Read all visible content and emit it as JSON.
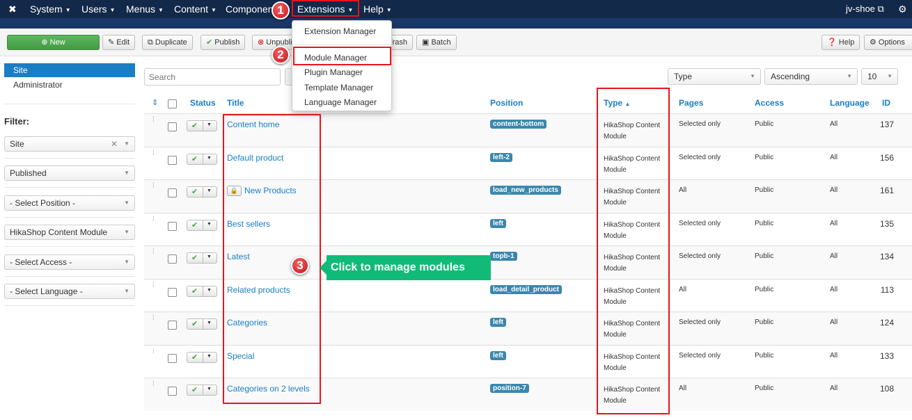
{
  "topnav": {
    "items": [
      "System",
      "Users",
      "Menus",
      "Content",
      "Components",
      "Extensions",
      "Help"
    ],
    "user": "jv-shoe",
    "gear_icon": "gear-icon"
  },
  "toolbar": {
    "new": "New",
    "edit": "Edit",
    "duplicate": "Duplicate",
    "publish": "Publish",
    "unpublish": "Unpublish",
    "trash": "Trash",
    "batch": "Batch",
    "help": "Help",
    "options": "Options"
  },
  "extensions_menu": [
    "Extension Manager",
    "Module Manager",
    "Plugin Manager",
    "Template Manager",
    "Language Manager"
  ],
  "sidebar": {
    "items": [
      "Site",
      "Administrator"
    ],
    "filter_label": "Filter:",
    "filters": [
      "Site",
      "Published",
      "- Select Position -",
      "HikaShop Content Module",
      "- Select Access -",
      "- Select Language -"
    ]
  },
  "search": {
    "placeholder": "Search"
  },
  "sorting": {
    "field": "Type",
    "direction": "Ascending",
    "limit": "10"
  },
  "table": {
    "headers": [
      "Status",
      "Title",
      "Position",
      "Type",
      "Pages",
      "Access",
      "Language",
      "ID"
    ],
    "rows": [
      {
        "title": "Content home",
        "position": "content-bottom",
        "type": "HikaShop Content Module",
        "pages": "Selected only",
        "access": "Public",
        "language": "All",
        "id": "137",
        "locked": false
      },
      {
        "title": "Default product",
        "position": "left-2",
        "type": "HikaShop Content Module",
        "pages": "Selected only",
        "access": "Public",
        "language": "All",
        "id": "156",
        "locked": false
      },
      {
        "title": "New Products",
        "position": "load_new_products",
        "type": "HikaShop Content Module",
        "pages": "All",
        "access": "Public",
        "language": "All",
        "id": "161",
        "locked": true
      },
      {
        "title": "Best sellers",
        "position": "left",
        "type": "HikaShop Content Module",
        "pages": "Selected only",
        "access": "Public",
        "language": "All",
        "id": "135",
        "locked": false
      },
      {
        "title": "Latest",
        "position": "topb-1",
        "type": "HikaShop Content Module",
        "pages": "Selected only",
        "access": "Public",
        "language": "All",
        "id": "134",
        "locked": false
      },
      {
        "title": "Related products",
        "position": "load_detail_product",
        "type": "HikaShop Content Module",
        "pages": "All",
        "access": "Public",
        "language": "All",
        "id": "113",
        "locked": false
      },
      {
        "title": "Categories",
        "position": "left",
        "type": "HikaShop Content Module",
        "pages": "Selected only",
        "access": "Public",
        "language": "All",
        "id": "124",
        "locked": false
      },
      {
        "title": "Special",
        "position": "left",
        "type": "HikaShop Content Module",
        "pages": "Selected only",
        "access": "Public",
        "language": "All",
        "id": "133",
        "locked": false
      },
      {
        "title": "Categories on 2 levels",
        "position": "position-7",
        "type": "HikaShop Content Module",
        "pages": "All",
        "access": "Public",
        "language": "All",
        "id": "108",
        "locked": false
      }
    ]
  },
  "annotations": {
    "steps": [
      "1",
      "2",
      "3"
    ],
    "callout": "Click to manage modules",
    "highlight_color": "#e8141c",
    "callout_color": "#10bb78"
  }
}
